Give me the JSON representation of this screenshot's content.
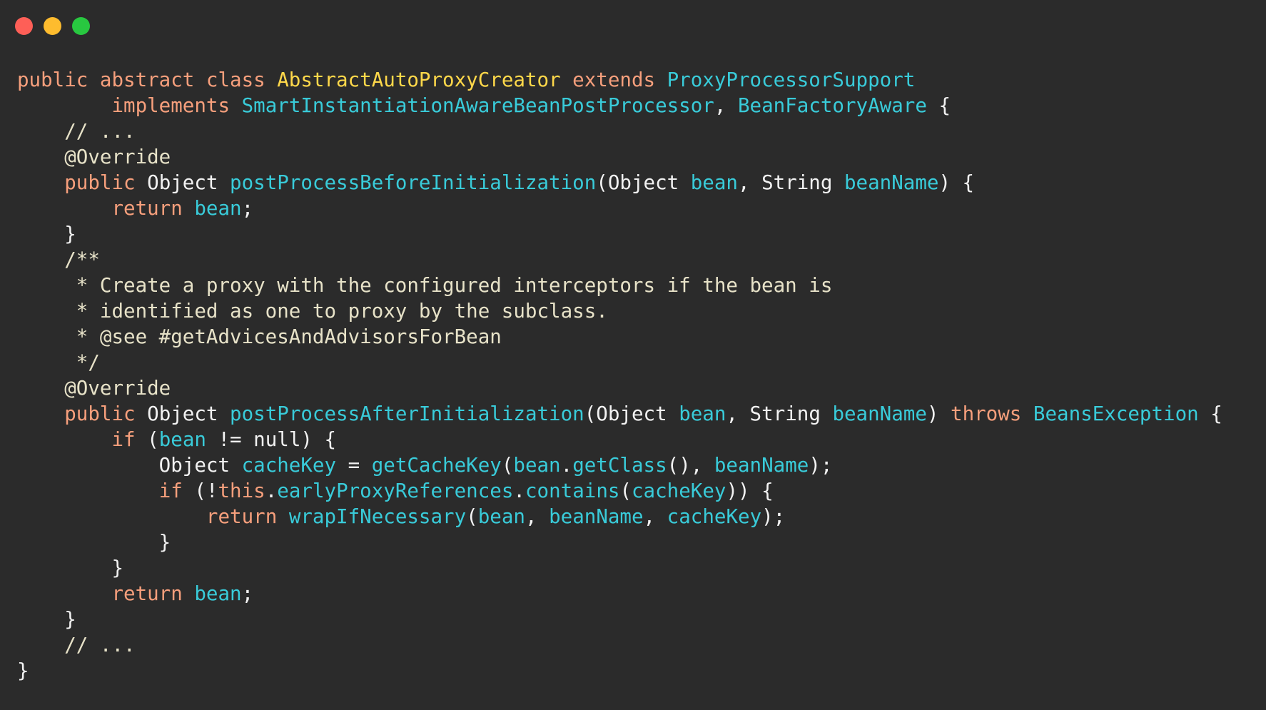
{
  "colors": {
    "background": "#2b2b2b",
    "close": "#fe5f57",
    "minimize": "#febc2e",
    "zoom": "#28c840",
    "kw": "#f69f7c",
    "cls": "#ffd84a",
    "fn": "#39cbd9",
    "plain": "#f2f2f2",
    "comment": "#e7e2c8"
  },
  "window_controls": [
    {
      "name": "close-button",
      "color": "#fe5f57"
    },
    {
      "name": "minimize-button",
      "color": "#febc2e"
    },
    {
      "name": "zoom-button",
      "color": "#28c840"
    }
  ],
  "code_lines": [
    [
      {
        "t": "public abstract class ",
        "c": "kw"
      },
      {
        "t": "AbstractAutoProxyCreator",
        "c": "cls"
      },
      {
        "t": " extends ",
        "c": "kw"
      },
      {
        "t": "ProxyProcessorSupport",
        "c": "fn"
      }
    ],
    [
      {
        "t": "        ",
        "c": "plain"
      },
      {
        "t": "implements",
        "c": "kw"
      },
      {
        "t": " ",
        "c": "plain"
      },
      {
        "t": "SmartInstantiationAwareBeanPostProcessor",
        "c": "fn"
      },
      {
        "t": ", ",
        "c": "plain"
      },
      {
        "t": "BeanFactoryAware",
        "c": "fn"
      },
      {
        "t": " {",
        "c": "plain"
      }
    ],
    [
      {
        "t": "    // ...",
        "c": "comment"
      }
    ],
    [
      {
        "t": "    @Override",
        "c": "comment"
      }
    ],
    [
      {
        "t": "    ",
        "c": "plain"
      },
      {
        "t": "public",
        "c": "kw"
      },
      {
        "t": " Object ",
        "c": "plain"
      },
      {
        "t": "postProcessBeforeInitialization",
        "c": "fn"
      },
      {
        "t": "(Object ",
        "c": "plain"
      },
      {
        "t": "bean",
        "c": "fn"
      },
      {
        "t": ", String ",
        "c": "plain"
      },
      {
        "t": "beanName",
        "c": "fn"
      },
      {
        "t": ") {",
        "c": "plain"
      }
    ],
    [
      {
        "t": "        ",
        "c": "plain"
      },
      {
        "t": "return",
        "c": "kw"
      },
      {
        "t": " ",
        "c": "plain"
      },
      {
        "t": "bean",
        "c": "fn"
      },
      {
        "t": ";",
        "c": "plain"
      }
    ],
    [
      {
        "t": "    }",
        "c": "plain"
      }
    ],
    [
      {
        "t": "    /**",
        "c": "comment"
      }
    ],
    [
      {
        "t": "     * Create a proxy with the configured interceptors if the bean is",
        "c": "comment"
      }
    ],
    [
      {
        "t": "     * identified as one to proxy by the subclass.",
        "c": "comment"
      }
    ],
    [
      {
        "t": "     * @see #getAdvicesAndAdvisorsForBean",
        "c": "comment"
      }
    ],
    [
      {
        "t": "     */",
        "c": "comment"
      }
    ],
    [
      {
        "t": "    @Override",
        "c": "comment"
      }
    ],
    [
      {
        "t": "    ",
        "c": "plain"
      },
      {
        "t": "public",
        "c": "kw"
      },
      {
        "t": " Object ",
        "c": "plain"
      },
      {
        "t": "postProcessAfterInitialization",
        "c": "fn"
      },
      {
        "t": "(Object ",
        "c": "plain"
      },
      {
        "t": "bean",
        "c": "fn"
      },
      {
        "t": ", String ",
        "c": "plain"
      },
      {
        "t": "beanName",
        "c": "fn"
      },
      {
        "t": ") ",
        "c": "plain"
      },
      {
        "t": "throws",
        "c": "kw"
      },
      {
        "t": " ",
        "c": "plain"
      },
      {
        "t": "BeansException",
        "c": "fn"
      },
      {
        "t": " {",
        "c": "plain"
      }
    ],
    [
      {
        "t": "        ",
        "c": "plain"
      },
      {
        "t": "if",
        "c": "kw"
      },
      {
        "t": " (",
        "c": "plain"
      },
      {
        "t": "bean",
        "c": "fn"
      },
      {
        "t": " != null) {",
        "c": "plain"
      }
    ],
    [
      {
        "t": "            Object ",
        "c": "plain"
      },
      {
        "t": "cacheKey",
        "c": "fn"
      },
      {
        "t": " = ",
        "c": "plain"
      },
      {
        "t": "getCacheKey",
        "c": "fn"
      },
      {
        "t": "(",
        "c": "plain"
      },
      {
        "t": "bean",
        "c": "fn"
      },
      {
        "t": ".",
        "c": "plain"
      },
      {
        "t": "getClass",
        "c": "fn"
      },
      {
        "t": "(), ",
        "c": "plain"
      },
      {
        "t": "beanName",
        "c": "fn"
      },
      {
        "t": ");",
        "c": "plain"
      }
    ],
    [
      {
        "t": "            ",
        "c": "plain"
      },
      {
        "t": "if",
        "c": "kw"
      },
      {
        "t": " (!",
        "c": "plain"
      },
      {
        "t": "this",
        "c": "kw"
      },
      {
        "t": ".",
        "c": "plain"
      },
      {
        "t": "earlyProxyReferences",
        "c": "fn"
      },
      {
        "t": ".",
        "c": "plain"
      },
      {
        "t": "contains",
        "c": "fn"
      },
      {
        "t": "(",
        "c": "plain"
      },
      {
        "t": "cacheKey",
        "c": "fn"
      },
      {
        "t": ")) {",
        "c": "plain"
      }
    ],
    [
      {
        "t": "                ",
        "c": "plain"
      },
      {
        "t": "return",
        "c": "kw"
      },
      {
        "t": " ",
        "c": "plain"
      },
      {
        "t": "wrapIfNecessary",
        "c": "fn"
      },
      {
        "t": "(",
        "c": "plain"
      },
      {
        "t": "bean",
        "c": "fn"
      },
      {
        "t": ", ",
        "c": "plain"
      },
      {
        "t": "beanName",
        "c": "fn"
      },
      {
        "t": ", ",
        "c": "plain"
      },
      {
        "t": "cacheKey",
        "c": "fn"
      },
      {
        "t": ");",
        "c": "plain"
      }
    ],
    [
      {
        "t": "            }",
        "c": "plain"
      }
    ],
    [
      {
        "t": "        }",
        "c": "plain"
      }
    ],
    [
      {
        "t": "        ",
        "c": "plain"
      },
      {
        "t": "return",
        "c": "kw"
      },
      {
        "t": " ",
        "c": "plain"
      },
      {
        "t": "bean",
        "c": "fn"
      },
      {
        "t": ";",
        "c": "plain"
      }
    ],
    [
      {
        "t": "    }",
        "c": "plain"
      }
    ],
    [
      {
        "t": "    // ...",
        "c": "comment"
      }
    ],
    [
      {
        "t": "}",
        "c": "plain"
      }
    ]
  ]
}
